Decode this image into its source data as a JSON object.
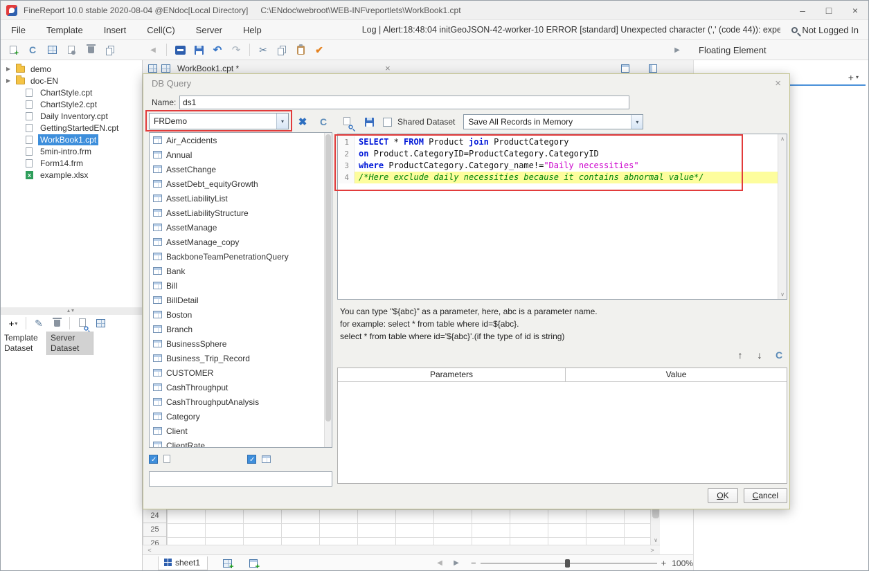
{
  "window": {
    "title": "FineReport 10.0 stable 2020-08-04 @ENdoc[Local Directory]",
    "path": "C:\\ENdoc\\webroot\\WEB-INF\\reportlets\\WorkBook1.cpt"
  },
  "icons": {
    "minimize": "–",
    "maximize": "□",
    "close": "×",
    "back": "◀",
    "forward": "▶",
    "undo": "↶",
    "redo": "↷",
    "cut": "✂",
    "format_check": "✔",
    "pencil": "✎",
    "plus": "+",
    "dropdown": "▾",
    "splitter": "▴▾",
    "scroll_up": "∧",
    "scroll_down": "∨",
    "scroll_left": "<",
    "scroll_right": ">",
    "param_up": "↑",
    "param_down": "↓",
    "refresh": "C",
    "tools": "✖",
    "minus": "−",
    "nav_left": "◀",
    "nav_right": "▶"
  },
  "menubar": {
    "items": [
      "File",
      "Template",
      "Insert",
      "Cell(C)",
      "Server",
      "Help"
    ],
    "log_message": "Log | Alert:18:48:04 initGeoJSON-42-worker-10 ERROR [standard] Unexpected character (',' (code 44)): expe...",
    "login_status": "Not Logged In"
  },
  "workspace": {
    "tab_title": "WorkBook1.cpt *",
    "floating_panel_title": "Floating Element",
    "row_headers": [
      "24",
      "25",
      "26"
    ],
    "sheet_tab": "sheet1",
    "zoom_level": "100%"
  },
  "sidebar": {
    "tree": [
      {
        "label": "demo",
        "cls": "folder"
      },
      {
        "label": "doc-EN",
        "cls": "folder"
      },
      {
        "label": "ChartStyle.cpt",
        "cls": "file"
      },
      {
        "label": "ChartStyle2.cpt",
        "cls": "file"
      },
      {
        "label": "Daily Inventory.cpt",
        "cls": "file"
      },
      {
        "label": "GettingStartedEN.cpt",
        "cls": "file"
      },
      {
        "label": "WorkBook1.cpt",
        "cls": "file selected"
      },
      {
        "label": "5min-intro.frm",
        "cls": "file"
      },
      {
        "label": "Form14.frm",
        "cls": "file"
      },
      {
        "label": "example.xlsx",
        "cls": "excel"
      }
    ],
    "dataset_tabs": [
      {
        "label": "Template Dataset",
        "cls": "active"
      },
      {
        "label": "Server Dataset",
        "cls": ""
      }
    ]
  },
  "dialog": {
    "title": "DB Query",
    "name_label": "Name:",
    "name_value": "ds1",
    "connection": "FRDemo",
    "tables": [
      "Air_Accidents",
      "Annual",
      "AssetChange",
      "AssetDebt_equityGrowth",
      "AssetLiabilityList",
      "AssetLiabilityStructure",
      "AssetManage",
      "AssetManage_copy",
      "BackboneTeamPenetrationQuery",
      "Bank",
      "Bill",
      "BillDetail",
      "Boston",
      "Branch",
      "BusinessSphere",
      "Business_Trip_Record",
      "CUSTOMER",
      "CashThroughput",
      "CashThroughputAnalysis",
      "Category",
      "Client",
      "ClientRate"
    ],
    "shared_dataset_label": "Shared Dataset",
    "store_mode": "Save All Records in Memory",
    "sql_lines": [
      {
        "num": "1",
        "hl": false,
        "tokens": [
          [
            "kw",
            "SELECT"
          ],
          [
            "pl",
            " * "
          ],
          [
            "kw",
            "FROM"
          ],
          [
            "pl",
            " Product "
          ],
          [
            "kw",
            "join"
          ],
          [
            "pl",
            " ProductCategory"
          ]
        ]
      },
      {
        "num": "2",
        "hl": false,
        "tokens": [
          [
            "kw",
            "on"
          ],
          [
            "pl",
            " Product.CategoryID=ProductCategory.CategoryID"
          ]
        ]
      },
      {
        "num": "3",
        "hl": false,
        "tokens": [
          [
            "kw",
            "where"
          ],
          [
            "pl",
            " ProductCategory.Category_name!="
          ],
          [
            "str",
            "\"Daily necessities\""
          ]
        ]
      },
      {
        "num": "4",
        "hl": true,
        "tokens": [
          [
            "cm",
            "/*Here exclude daily necessities because it contains abnormal value*/"
          ]
        ]
      }
    ],
    "hint_lines": [
      "You can type \"${abc}\" as a parameter, here, abc is a parameter name.",
      "for example: select * from table where id=${abc}.",
      "select * from table where id='${abc}'.(if the type of id is string)"
    ],
    "param_headers": [
      "Parameters",
      "Value"
    ],
    "ok_label": "OK",
    "cancel_label": "Cancel"
  }
}
